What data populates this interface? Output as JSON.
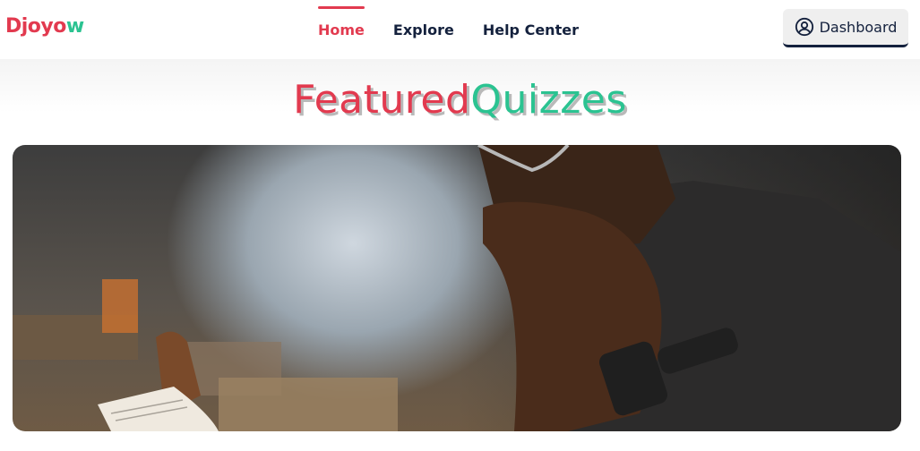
{
  "brand": {
    "part1": "Djoyo",
    "part2": "w"
  },
  "nav": {
    "items": [
      {
        "label": "Home",
        "active": true
      },
      {
        "label": "Explore",
        "active": false
      },
      {
        "label": "Help Center",
        "active": false
      }
    ]
  },
  "header": {
    "dashboard_label": "Dashboard"
  },
  "featured": {
    "title_part1": "Featured",
    "title_part2": "Quizzes"
  },
  "colors": {
    "accent_red": "#e23a4f",
    "accent_green": "#2bc391",
    "dark_navy": "#14213d"
  },
  "icons": {
    "dashboard": "user-circle-icon"
  }
}
